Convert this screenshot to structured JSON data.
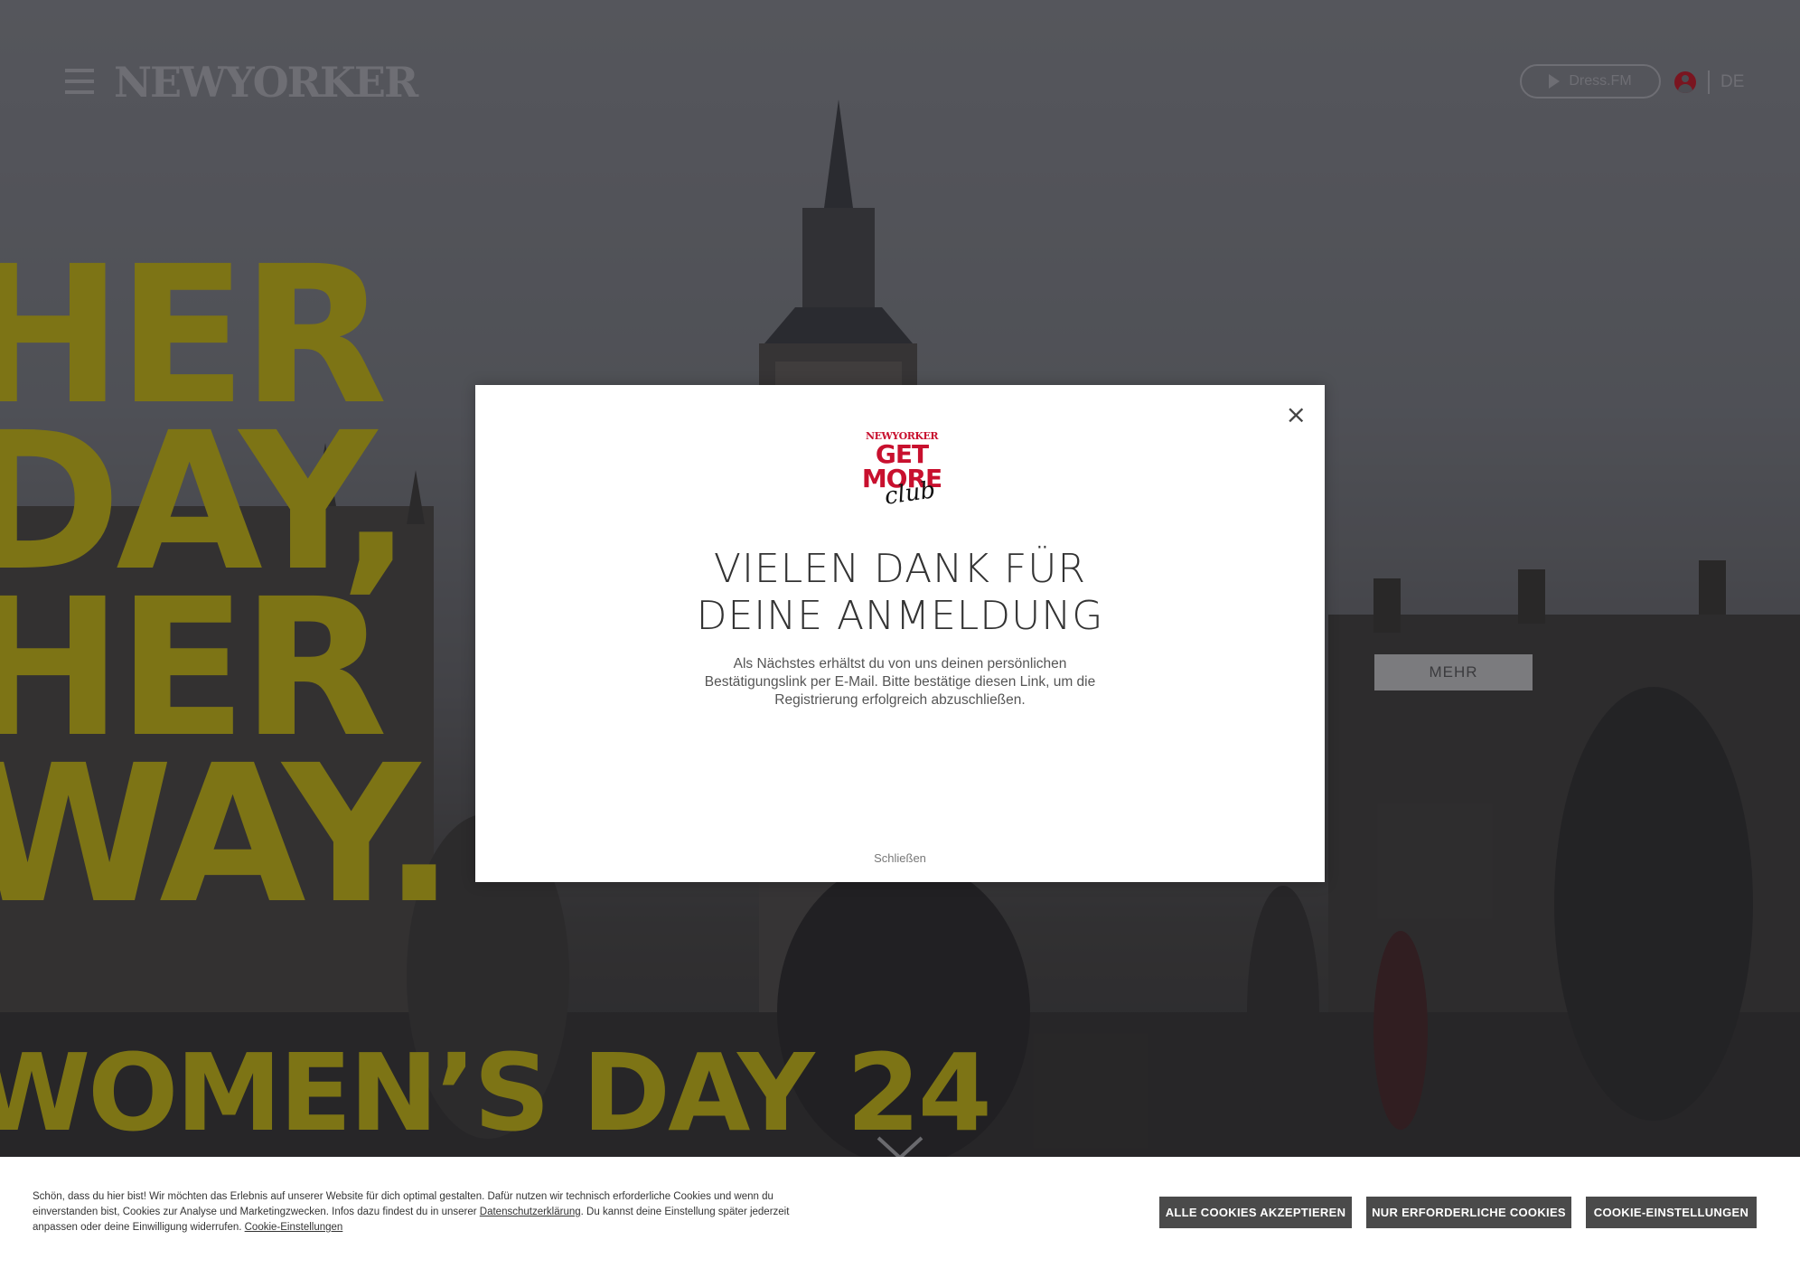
{
  "header": {
    "logo_text": "NEWYORKER",
    "dress_fm_label": "Dress.FM",
    "language": "DE"
  },
  "hero": {
    "headline_lines": [
      "HER",
      "DAY,",
      "HER",
      "WAY."
    ],
    "subline": "WOMEN’S DAY 24",
    "more_label": "MEHR",
    "headline_color": "#7d7415"
  },
  "modal": {
    "logo_brand": "NEWYORKER",
    "logo_get_more": [
      "GET",
      "MORE"
    ],
    "logo_club": "club",
    "title_lines": [
      "VIELEN DANK FÜR",
      "DEINE ANMELDUNG"
    ],
    "body_text": "Als Nächstes erhältst du von uns deinen persönlichen Bestätigungslink per E-Mail. Bitte bestätige diesen Link, um die Registrierung erfolgreich abzuschließen.",
    "close_icon": "×",
    "close_link": "Schließen",
    "brand_color": "#c8102e"
  },
  "cookie": {
    "text_part1": "Schön, dass du hier bist! Wir möchten das Erlebnis auf unserer Website für dich optimal gestalten. Dafür nutzen wir technisch erforderliche Cookies und wenn du einverstanden bist, Cookies zur Analyse und Marketingzwecken. Infos dazu findest du in unserer ",
    "privacy_link": "Datenschutzerklärung",
    "text_part2": ". Du kannst deine Einstellung später jederzeit anpassen oder deine Einwilligung widerrufen. ",
    "settings_link": "Cookie-Einstellungen",
    "buttons": {
      "accept_all": "ALLE COOKIES AKZEPTIEREN",
      "necessary_only": "NUR ERFORDERLICHE COOKIES",
      "settings": "COOKIE-EINSTELLUNGEN"
    },
    "button_color": "#4a4a4a"
  }
}
